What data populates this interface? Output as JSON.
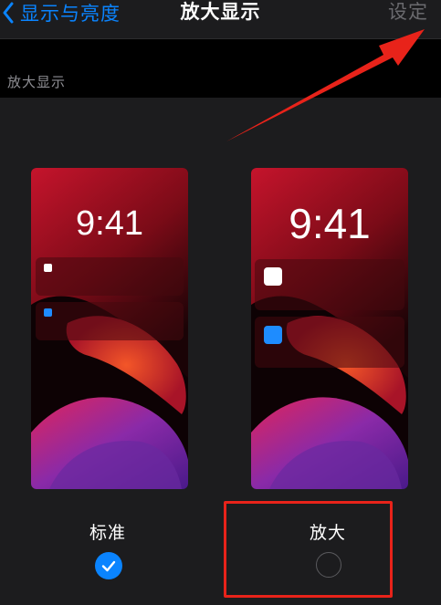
{
  "nav": {
    "back_label": "显示与亮度",
    "title": "放大显示",
    "action_label": "设定"
  },
  "section": {
    "header": "放大显示"
  },
  "options": [
    {
      "label": "标准",
      "clock": "9:41",
      "selected": true
    },
    {
      "label": "放大",
      "clock": "9:41",
      "selected": false
    }
  ],
  "colors": {
    "accent": "#0a84ff",
    "annotation": "#e8231a",
    "notification_dot_blue": "#1e8cff"
  }
}
